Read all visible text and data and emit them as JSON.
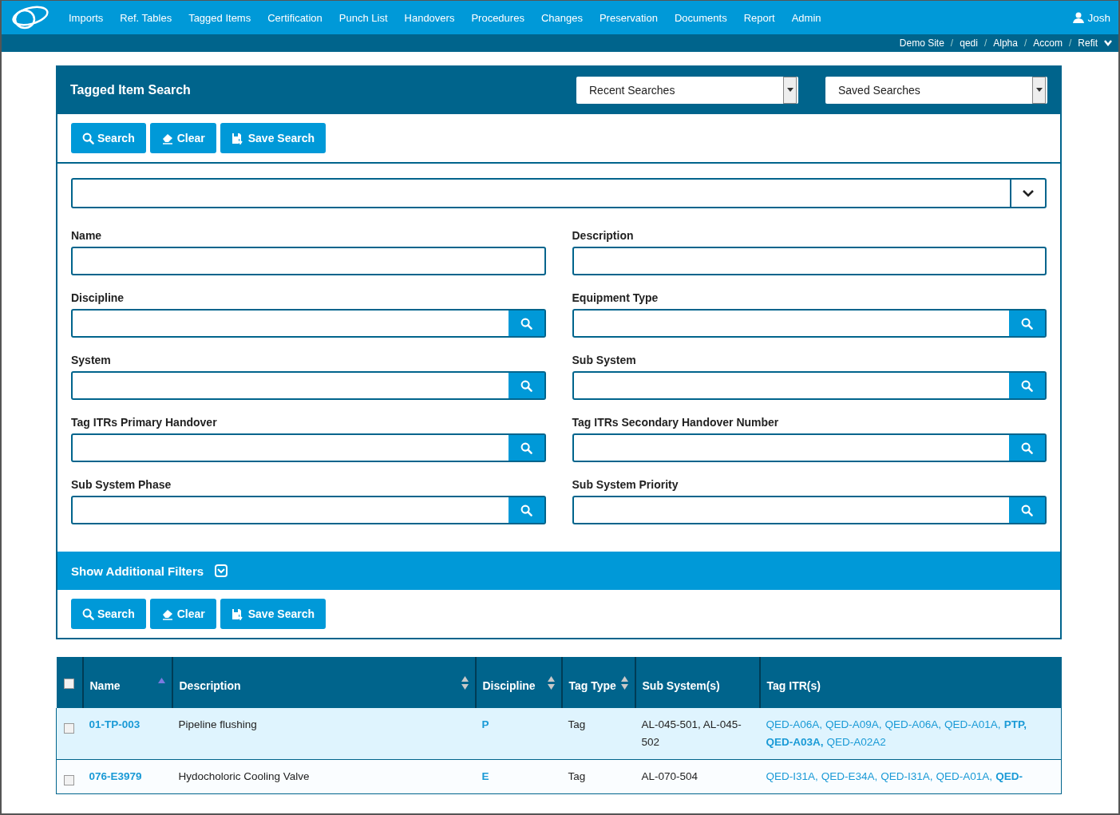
{
  "nav": {
    "items": [
      "Imports",
      "Ref. Tables",
      "Tagged Items",
      "Certification",
      "Punch List",
      "Handovers",
      "Procedures",
      "Changes",
      "Preservation",
      "Documents",
      "Report",
      "Admin"
    ],
    "user": "Josh"
  },
  "breadcrumb": {
    "separator": "/",
    "items": [
      "Demo Site",
      "qedi",
      "Alpha",
      "Accom",
      "Refit"
    ]
  },
  "panel": {
    "title": "Tagged Item Search",
    "dropdowns": [
      {
        "value": "Recent Searches"
      },
      {
        "value": "Saved Searches"
      }
    ],
    "buttons": [
      {
        "kind": "search",
        "label": "Search"
      },
      {
        "kind": "clear",
        "label": "Clear"
      },
      {
        "kind": "save",
        "label": "Save Search"
      }
    ],
    "fields": [
      {
        "label": "Name",
        "kind": "text"
      },
      {
        "label": "Description",
        "kind": "text"
      },
      {
        "label": "Discipline",
        "kind": "lookup"
      },
      {
        "label": "Equipment Type",
        "kind": "lookup"
      },
      {
        "label": "System",
        "kind": "lookup"
      },
      {
        "label": "Sub System",
        "kind": "lookup"
      },
      {
        "label": "Tag ITRs Primary Handover",
        "kind": "lookup"
      },
      {
        "label": "Tag ITRs Secondary Handover Number",
        "kind": "lookup"
      },
      {
        "label": "Sub System Phase",
        "kind": "lookup"
      },
      {
        "label": "Sub System Priority",
        "kind": "lookup"
      }
    ],
    "additional_filters": {
      "label": "Show Additional Filters",
      "expanded": false
    },
    "bottom_buttons": [
      {
        "kind": "search",
        "label": "Search"
      },
      {
        "kind": "clear",
        "label": "Clear"
      },
      {
        "kind": "save",
        "label": "Save Search"
      }
    ]
  },
  "table": {
    "select_all_checked": false,
    "columns": [
      {
        "label": "Name",
        "sortable": true,
        "sorted": true
      },
      {
        "label": "Description",
        "sortable": true,
        "sorted": false
      },
      {
        "label": "Discipline",
        "sortable": true,
        "sorted": false
      },
      {
        "label": "Tag Type",
        "sortable": true,
        "sorted": false
      },
      {
        "label": "Sub System(s)",
        "sortable": false
      },
      {
        "label": "Tag ITR(s)",
        "sortable": false
      }
    ],
    "rows": [
      {
        "checked": false,
        "selected": true,
        "name": "01-TP-003",
        "description": "Pipeline flushing",
        "discipline": "P",
        "tag_type": "Tag",
        "sub_systems": "AL-045-501, AL-045-502",
        "itrs": [
          {
            "text": "QED-A06A,",
            "bold": false
          },
          {
            "text": "QED-A09A,",
            "bold": false
          },
          {
            "text": "QED-A06A,",
            "bold": false
          },
          {
            "text": "QED-A01A,",
            "bold": false
          },
          {
            "text": "PTP,",
            "bold": true
          },
          {
            "text": "QED-A03A,",
            "bold": true
          },
          {
            "text": "QED-A02A2",
            "bold": false
          }
        ]
      },
      {
        "checked": false,
        "selected": false,
        "name": "076-E3979",
        "description": "Hydocholoric Cooling Valve",
        "discipline": "E",
        "tag_type": "Tag",
        "sub_systems": "AL-070-504",
        "itrs": [
          {
            "text": "QED-I31A,",
            "bold": false
          },
          {
            "text": "QED-E34A,",
            "bold": false
          },
          {
            "text": "QED-I31A,",
            "bold": false
          },
          {
            "text": "QED-A01A,",
            "bold": false
          },
          {
            "text": "QED-",
            "bold": true
          }
        ]
      }
    ]
  }
}
